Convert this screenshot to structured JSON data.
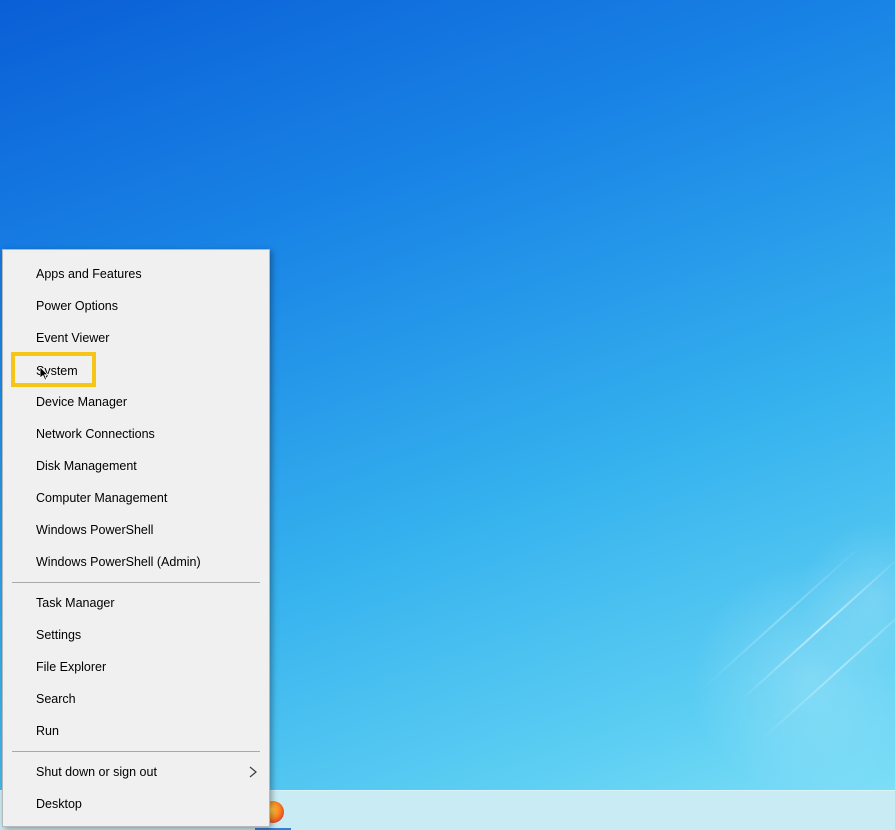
{
  "menu": {
    "group1": [
      {
        "label": "Apps and Features",
        "name": "menu-item-apps-and-features"
      },
      {
        "label": "Power Options",
        "name": "menu-item-power-options"
      },
      {
        "label": "Event Viewer",
        "name": "menu-item-event-viewer"
      },
      {
        "label": "System",
        "name": "menu-item-system"
      },
      {
        "label": "Device Manager",
        "name": "menu-item-device-manager"
      },
      {
        "label": "Network Connections",
        "name": "menu-item-network-connections"
      },
      {
        "label": "Disk Management",
        "name": "menu-item-disk-management"
      },
      {
        "label": "Computer Management",
        "name": "menu-item-computer-management"
      },
      {
        "label": "Windows PowerShell",
        "name": "menu-item-windows-powershell"
      },
      {
        "label": "Windows PowerShell (Admin)",
        "name": "menu-item-windows-powershell-admin"
      }
    ],
    "group2": [
      {
        "label": "Task Manager",
        "name": "menu-item-task-manager"
      },
      {
        "label": "Settings",
        "name": "menu-item-settings"
      },
      {
        "label": "File Explorer",
        "name": "menu-item-file-explorer"
      },
      {
        "label": "Search",
        "name": "menu-item-search"
      },
      {
        "label": "Run",
        "name": "menu-item-run"
      }
    ],
    "group3": [
      {
        "label": "Shut down or sign out",
        "name": "menu-item-shut-down-or-sign-out",
        "has_submenu": true
      },
      {
        "label": "Desktop",
        "name": "menu-item-desktop"
      }
    ],
    "highlighted_item": "System",
    "highlight_color": "#f5c518",
    "submenu_icon": "chevron-right-icon"
  },
  "taskbar": {
    "app_icon": "firefox-icon",
    "active_indicator_color": "#2f7fd8"
  }
}
